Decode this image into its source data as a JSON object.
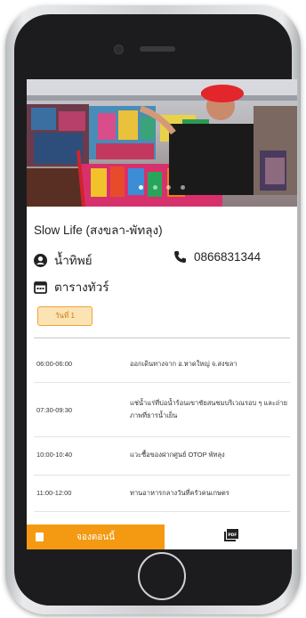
{
  "tour": {
    "title": "Slow Life (สงขลา-พัทลุง)",
    "guide_name": "น้ำทิพย์",
    "phone": "0866831344",
    "schedule_label": "ตารางทัวร์",
    "day_chip": "วันที่ 1"
  },
  "carousel": {
    "total": 4,
    "active": 1
  },
  "schedule": [
    {
      "time": "06:00-06:00",
      "desc": "ออกเดินทางจาก อ.หาดใหญ่ จ.สงขลา"
    },
    {
      "time": "07:30-09:30",
      "desc": "แช่น้ำแร่ที่บ่อน้ำร้อนเขาชัยสนชมบริเวณรอบ ๆ และถ่ายภาพที่ธารน้ำเย็น"
    },
    {
      "time": "10:00-10:40",
      "desc": "แวะซื้อของฝากศูนย์ OTOP พัทลุง"
    },
    {
      "time": "11:00-12:00",
      "desc": "ทานอาหารกลางวันที่ครัวคนเกษตร"
    }
  ],
  "actions": {
    "book_label": "จองตอนนี้",
    "pdf_icon": "pdf-icon"
  },
  "colors": {
    "accent": "#f39a12",
    "chip_bg": "#fbe3b3"
  }
}
